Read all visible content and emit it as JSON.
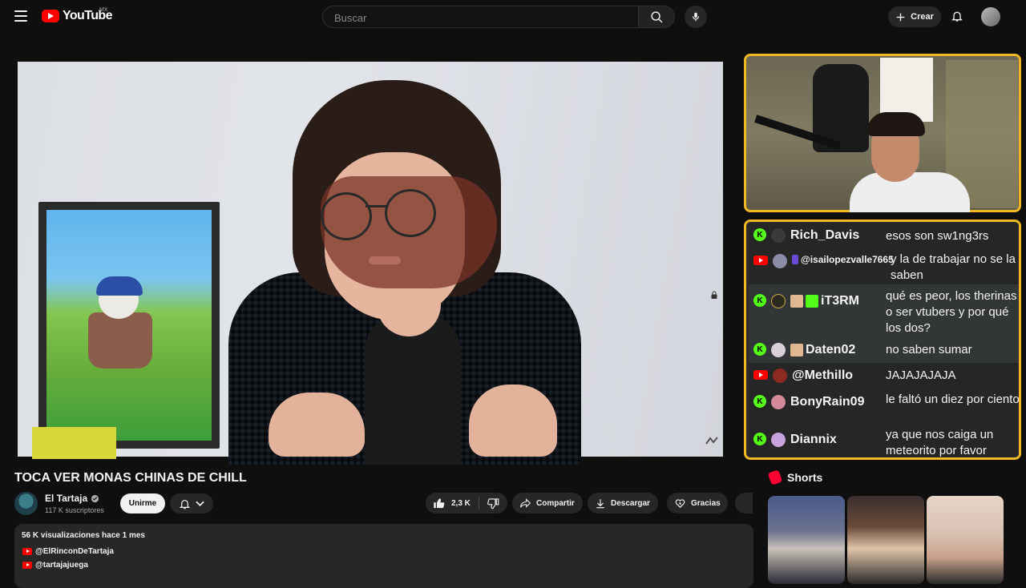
{
  "header": {
    "logo_text": "YouTube",
    "country": "MX",
    "search_placeholder": "Buscar",
    "create_label": "Crear"
  },
  "video": {
    "title": "TOCA VER MONAS CHINAS DE CHILL"
  },
  "channel": {
    "name": "El Tartaja",
    "subscribers": "117 K suscriptores",
    "join_label": "Unirme"
  },
  "actions": {
    "likes": "2,3 K",
    "share_label": "Compartir",
    "download_label": "Descargar",
    "thanks_label": "Gracias"
  },
  "description": {
    "meta": "56 K visualizaciones  hace 1 mes",
    "links": [
      "@ElRinconDeTartaja",
      "@tartajajuega"
    ]
  },
  "chat": [
    {
      "platform": "kick",
      "user": "Rich_Davis",
      "message": "esos son sw1ng3rs",
      "avatar": "#3a3a3a"
    },
    {
      "platform": "youtube",
      "user": "@isailopezvalle7665",
      "message": "y la de trabajar no se la saben",
      "avatar": "#8c8ca8"
    },
    {
      "platform": "kick",
      "user": "iT3RM",
      "message": "qué es peor, los therinas o ser vtubers y por qué los dos?",
      "avatar": "#2d2a1f"
    },
    {
      "platform": "kick",
      "user": "Daten02",
      "message": "no saben sumar",
      "avatar": "#d8d0d8"
    },
    {
      "platform": "youtube",
      "user": "@Methillo",
      "message": "JAJAJAJAJA",
      "avatar": "#8a2a20"
    },
    {
      "platform": "kick",
      "user": "BonyRain09",
      "message": "le faltó un diez por ciento",
      "avatar": "#d48a9a"
    },
    {
      "platform": "kick",
      "user": "Diannix",
      "message": "ya que nos caiga un meteorito por favor",
      "avatar": "#c9a3e0"
    }
  ],
  "shorts": {
    "heading": "Shorts"
  },
  "colors": {
    "accent_red": "#ff0000",
    "overlay_border": "#f0b825",
    "kick_green": "#53fc18",
    "background": "#0f0f0f"
  },
  "icons": [
    "menu-icon",
    "search-icon",
    "mic-icon",
    "plus-icon",
    "bell-icon",
    "verified-icon",
    "like-icon",
    "dislike-icon",
    "share-icon",
    "download-icon",
    "thanks-icon",
    "shorts-icon"
  ]
}
